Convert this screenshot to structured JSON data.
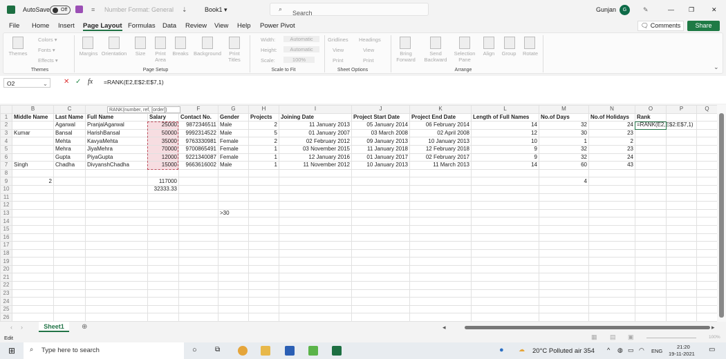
{
  "titlebar": {
    "autosave": "AutoSave",
    "toggle": "Off",
    "number_format": "Number Format: General",
    "book": "Book1 ▾",
    "search_placeholder": "Search",
    "user": "Gunjan",
    "avatar": "G"
  },
  "tabs": [
    "File",
    "Home",
    "Insert",
    "Page Layout",
    "Formulas",
    "Data",
    "Review",
    "View",
    "Help",
    "Power Pivot"
  ],
  "active_tab": "Page Layout",
  "buttons": {
    "comments": "Comments",
    "share": "Share"
  },
  "ribbon": {
    "groups": [
      "Themes",
      "Page Setup",
      "Scale to Fit",
      "Sheet Options",
      "Arrange"
    ],
    "themes": [
      "Themes",
      "Colors ▾",
      "Fonts ▾",
      "Effects ▾"
    ],
    "page_setup": [
      "Margins",
      "Orientation",
      "Size",
      "Print Area",
      "Breaks",
      "Background",
      "Print Titles"
    ],
    "scale": {
      "width": "Width:",
      "width_val": "Automatic",
      "height": "Height:",
      "height_val": "Automatic",
      "scale": "Scale:",
      "scale_val": "100%"
    },
    "sheet_options": {
      "gridlines": "Gridlines",
      "headings": "Headings",
      "view": "View",
      "print": "Print"
    },
    "arrange": [
      "Bring Forward",
      "Send Backward",
      "Selection Pane",
      "Align",
      "Group",
      "Rotate"
    ]
  },
  "formula_bar": {
    "name_box": "O2",
    "fx": "fx",
    "formula": "=RANK(E2,E$2:E$7,1)",
    "tooltip": "RANK(number, ref, [order])"
  },
  "sheet": {
    "columns": [
      "B",
      "C",
      "D",
      "E",
      "F",
      "G",
      "H",
      "I",
      "J",
      "K",
      "L",
      "M",
      "N",
      "O",
      "P",
      "Q"
    ],
    "rows": [
      [
        "Middle Name",
        "Last Name",
        "Full Name",
        "Salary",
        "Contact No.",
        "Gender",
        "Projects",
        "Joining Date",
        "Project Start Date",
        "Project End Date",
        "Length of Full Names",
        "No.of Days",
        "No.of Holidays",
        "Rank",
        "",
        ""
      ],
      [
        "",
        "Agarwal",
        "PranjalAgarwal",
        "25000",
        "9872346511",
        "Male",
        "2",
        "11 January 2013",
        "05 January 2014",
        "06 February 2014",
        "14",
        "32",
        "24",
        "=RANK(E2,E$2:E$7,1)",
        "",
        ""
      ],
      [
        "Kumar",
        "Bansal",
        "HarishBansal",
        "50000",
        "9992314522",
        "Male",
        "5",
        "01 January 2007",
        "03 March 2008",
        "02 April 2008",
        "12",
        "30",
        "23",
        "",
        "",
        ""
      ],
      [
        "",
        "Mehta",
        "KavyaMehta",
        "35000",
        "9763330981",
        "Female",
        "2",
        "02 February 2012",
        "09 January 2013",
        "10 January 2013",
        "10",
        "1",
        "2",
        "",
        "",
        ""
      ],
      [
        "",
        "Mehra",
        "JiyaMehra",
        "70000",
        "9700865491",
        "Female",
        "1",
        "03 November 2015",
        "11 January 2018",
        "12 February 2018",
        "9",
        "32",
        "23",
        "",
        "",
        ""
      ],
      [
        "",
        "Gupta",
        "PiyaGupta",
        "12000",
        "9221340087",
        "Female",
        "1",
        "12 January 2016",
        "01 January 2017",
        "02 February 2017",
        "9",
        "32",
        "24",
        "",
        "",
        ""
      ],
      [
        "Singh",
        "Chadha",
        "DivyanshChadha",
        "15000",
        "9663616002",
        "Male",
        "1",
        "11 November 2012",
        "10 January 2013",
        "11 March 2013",
        "14",
        "60",
        "43",
        "",
        "",
        ""
      ],
      [
        "",
        "",
        "",
        "",
        "",
        "",
        "",
        "",
        "",
        "",
        "",
        "",
        "",
        "",
        "",
        ""
      ],
      [
        "2",
        "",
        "",
        "117000",
        "",
        "",
        "",
        "",
        "",
        "",
        "",
        "4",
        "",
        "",
        "",
        ""
      ],
      [
        "",
        "",
        "",
        "32333.33",
        "",
        "",
        "",
        "",
        "",
        "",
        "",
        "",
        "",
        "",
        "",
        ""
      ],
      [
        "",
        "",
        "",
        "",
        "",
        "",
        "",
        "",
        "",
        "",
        "",
        "",
        "",
        "",
        "",
        ""
      ],
      [
        "",
        "",
        "",
        "",
        "",
        "",
        "",
        "",
        "",
        "",
        "",
        "",
        "",
        "",
        "",
        ""
      ],
      [
        "",
        "",
        "",
        "",
        "",
        ">30",
        "",
        "",
        "",
        "",
        "",
        "",
        "",
        "",
        "",
        ""
      ]
    ],
    "total_rows": 26,
    "sheet_tab": "Sheet1"
  },
  "status": {
    "mode": "Edit",
    "zoom": "100%"
  },
  "taskbar": {
    "search": "Type here to search",
    "weather": "20°C  Polluted air 354",
    "lang": "ENG",
    "time": "21:20",
    "date": "19-11-2021"
  },
  "colors": {
    "excel_green": "#217346",
    "selection": "#f7dde1"
  }
}
